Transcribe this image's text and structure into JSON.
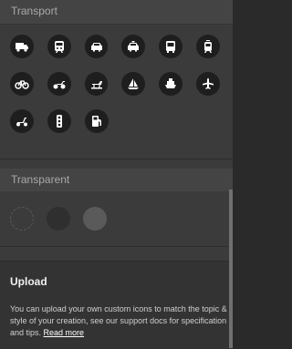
{
  "sections": {
    "transport": {
      "label": "Transport"
    },
    "transparent": {
      "label": "Transparent"
    }
  },
  "upload": {
    "title": "Upload",
    "text": "You can upload your own custom icons to match the topic & style of your creation, see our support docs for specification and tips. ",
    "link": "Read more"
  },
  "colors": {
    "icon_background": "#1e1e1e",
    "swatch_transparent_border": "#5a5a5a",
    "swatch_dark": "#2f2f2f",
    "swatch_grey": "#5a5a5a"
  },
  "icons": [
    [
      "truck-icon",
      "train-icon",
      "car-icon",
      "taxi-icon",
      "bus-icon",
      "tram-icon"
    ],
    [
      "bicycle-icon",
      "motorcycle-icon",
      "snowmobile-icon",
      "sailboat-icon",
      "ferry-icon",
      "airplane-icon"
    ],
    [
      "scooter-icon",
      "traffic-light-icon",
      "fuel-station-icon"
    ]
  ]
}
